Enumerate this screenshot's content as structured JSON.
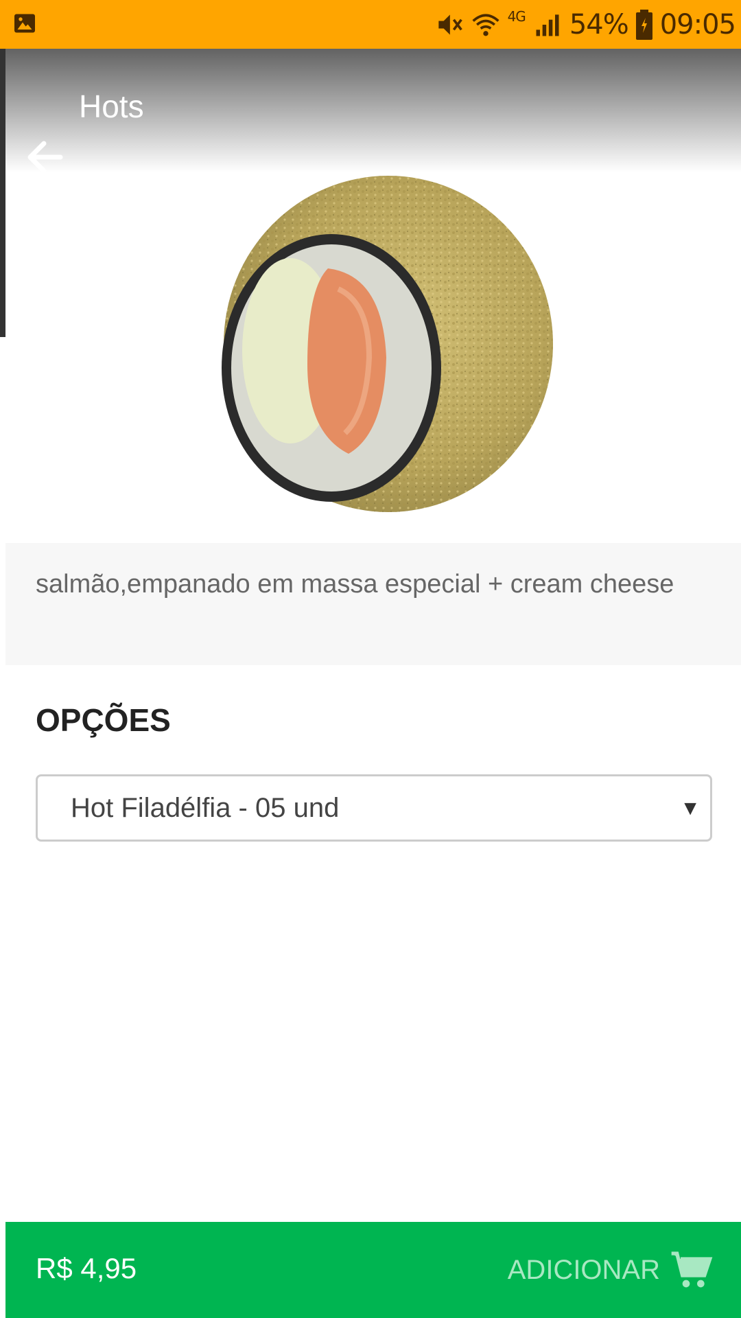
{
  "status_bar": {
    "battery": "54%",
    "time": "09:05",
    "network": "4G",
    "icons": [
      "gallery-icon",
      "mute-icon",
      "wifi-icon",
      "signal-icon",
      "battery-icon"
    ],
    "color": "#FFA500"
  },
  "header": {
    "title": "Hots",
    "back_icon": "arrow-left-icon"
  },
  "product": {
    "image": "sushi-roll-image",
    "description": "salmão,empanado em massa especial + cream cheese"
  },
  "options": {
    "title": "OPÇÕES",
    "selected": "Hot Filadélfia - 05 und",
    "arrow": "▼"
  },
  "footer": {
    "price": "R$ 4,95",
    "add_label": "ADICIONAR",
    "cart_icon": "cart-icon",
    "color": "#00B551"
  }
}
